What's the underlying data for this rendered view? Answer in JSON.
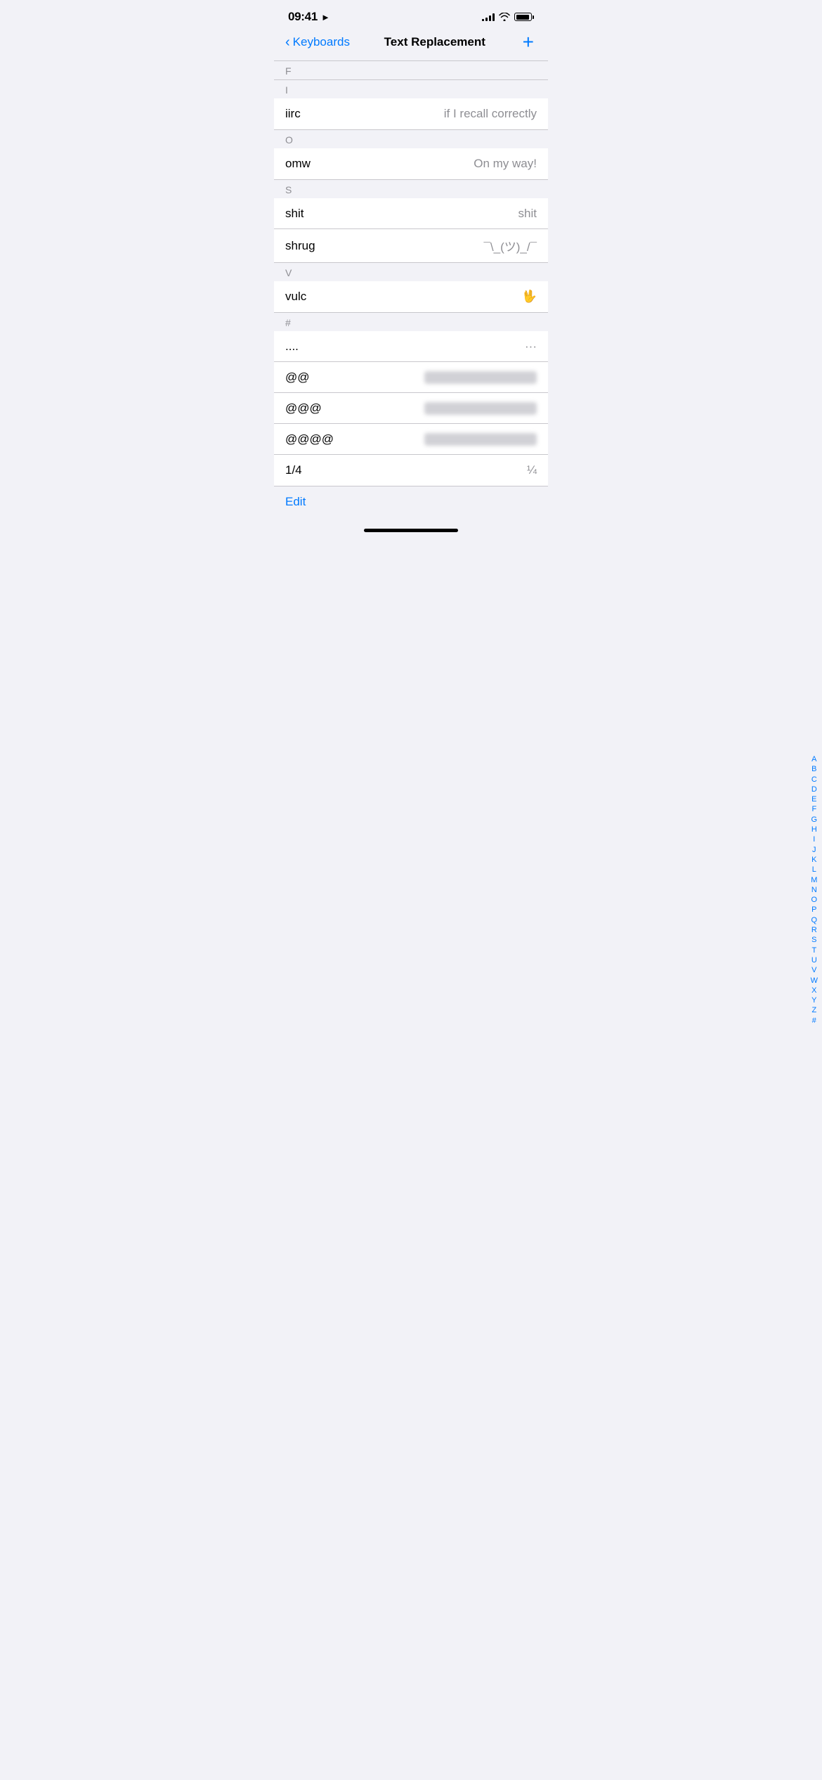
{
  "statusBar": {
    "time": "09:41",
    "locationIcon": "▶"
  },
  "nav": {
    "backLabel": "Keyboards",
    "title": "Text Replacement",
    "addLabel": "+"
  },
  "sections": [
    {
      "header": "F",
      "items": []
    },
    {
      "header": "I",
      "items": [
        {
          "shortcut": "iirc",
          "phrase": "if I recall correctly",
          "blurred": false
        }
      ]
    },
    {
      "header": "O",
      "items": [
        {
          "shortcut": "omw",
          "phrase": "On my way!",
          "blurred": false
        }
      ]
    },
    {
      "header": "S",
      "items": [
        {
          "shortcut": "shit",
          "phrase": "shit",
          "blurred": false
        },
        {
          "shortcut": "shrug",
          "phrase": "¯\\_(ツ)_/¯",
          "blurred": false
        }
      ]
    },
    {
      "header": "V",
      "items": [
        {
          "shortcut": "vulc",
          "phrase": "🖖",
          "blurred": false
        }
      ]
    },
    {
      "header": "#",
      "items": [
        {
          "shortcut": "....",
          "phrase": "···",
          "blurred": false
        },
        {
          "shortcut": "@@",
          "phrase": "████████████████",
          "blurred": true
        },
        {
          "shortcut": "@@@",
          "phrase": "████████████",
          "blurred": true
        },
        {
          "shortcut": "@@@@",
          "phrase": "████████████",
          "blurred": true
        },
        {
          "shortcut": "1/4",
          "phrase": "¼",
          "blurred": false
        }
      ]
    }
  ],
  "indexLetters": [
    "A",
    "B",
    "C",
    "D",
    "E",
    "F",
    "G",
    "H",
    "I",
    "J",
    "K",
    "L",
    "M",
    "N",
    "O",
    "P",
    "Q",
    "R",
    "S",
    "T",
    "U",
    "V",
    "W",
    "X",
    "Y",
    "Z",
    "#"
  ],
  "bottomBar": {
    "editLabel": "Edit"
  }
}
